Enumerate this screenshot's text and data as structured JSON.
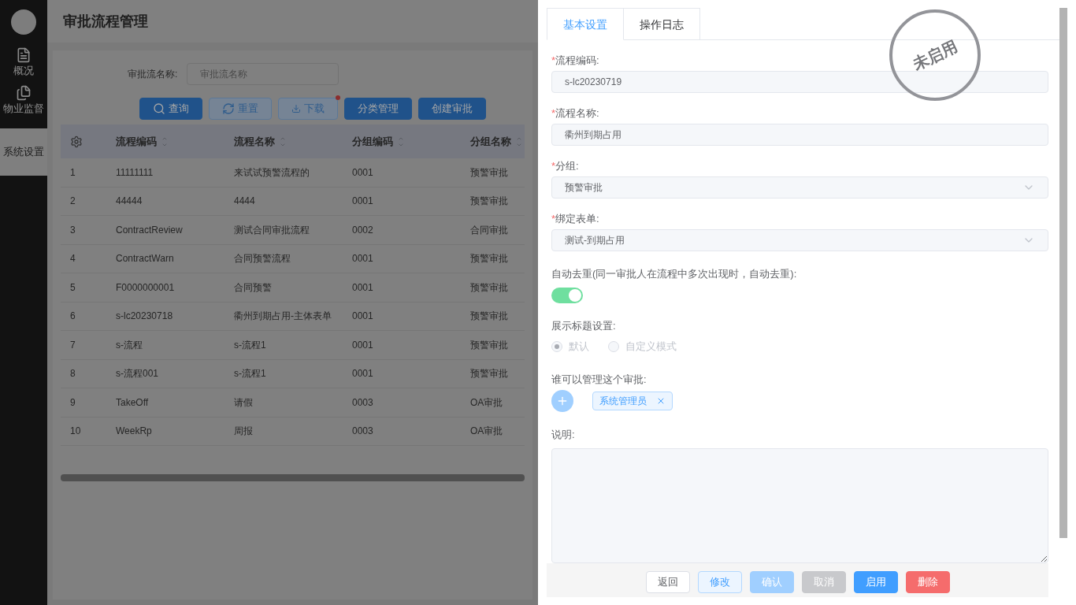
{
  "sidebar": {
    "items": [
      {
        "label": "概况",
        "selected": false
      },
      {
        "label": "物业监督",
        "selected": false
      },
      {
        "label": "系统设置",
        "selected": true
      }
    ]
  },
  "page": {
    "title": "审批流程管理"
  },
  "search": {
    "label": "审批流名称:",
    "placeholder": "审批流名称"
  },
  "toolbar": [
    {
      "label": "查询",
      "kind": "primary",
      "dot": false
    },
    {
      "label": "重置",
      "kind": "plain",
      "dot": false
    },
    {
      "label": "下载",
      "kind": "plain",
      "dot": true
    },
    {
      "label": "分类管理",
      "kind": "primary",
      "dot": false
    },
    {
      "label": "创建审批",
      "kind": "primary",
      "dot": false
    }
  ],
  "table": {
    "columns": [
      "",
      "流程编码",
      "流程名称",
      "分组编码",
      "分组名称"
    ],
    "rows": [
      [
        "1",
        "11111111",
        "来试试预警流程的",
        "0001",
        "预警审批"
      ],
      [
        "2",
        "44444",
        "4444",
        "0001",
        "预警审批"
      ],
      [
        "3",
        "ContractReview",
        "测试合同审批流程",
        "0002",
        "合同审批"
      ],
      [
        "4",
        "ContractWarn",
        "合同预警流程",
        "0001",
        "预警审批"
      ],
      [
        "5",
        "F0000000001",
        "合同预警",
        "0001",
        "预警审批"
      ],
      [
        "6",
        "s-lc20230718",
        "衢州到期占用-主体表单",
        "0001",
        "预警审批"
      ],
      [
        "7",
        "s-流程",
        "s-流程1",
        "0001",
        "预警审批"
      ],
      [
        "8",
        "s-流程001",
        "s-流程1",
        "0001",
        "预警审批"
      ],
      [
        "9",
        "TakeOff",
        "请假",
        "0003",
        "OA审批"
      ],
      [
        "10",
        "WeekRp",
        "周报",
        "0003",
        "OA审批"
      ]
    ]
  },
  "drawer": {
    "tabs": [
      {
        "label": "基本设置",
        "selected": true
      },
      {
        "label": "操作日志",
        "selected": false
      }
    ],
    "stamp": "未启用",
    "fields": [
      {
        "required_mark": "*",
        "label": "流程编码:",
        "kind": "input",
        "value": "s-lc20230719"
      },
      {
        "required_mark": "*",
        "label": "流程名称:",
        "kind": "input",
        "value": "衢州到期占用"
      },
      {
        "required_mark": "*",
        "label": "分组:",
        "kind": "select",
        "value": "预警审批"
      },
      {
        "required_mark": "*",
        "label": "绑定表单:",
        "kind": "select",
        "value": "测试-到期占用"
      }
    ],
    "dedupe": {
      "label": "自动去重(同一审批人在流程中多次出现时，自动去重):",
      "on": true
    },
    "title_setting": {
      "label": "展示标题设置:",
      "options": [
        {
          "label": "默认",
          "selected": true,
          "disabled": true
        },
        {
          "label": "自定义模式",
          "selected": false,
          "disabled": true
        }
      ]
    },
    "managers": {
      "label": "谁可以管理这个审批:",
      "tags": [
        "系统管理员"
      ]
    },
    "description": {
      "label": "说明:"
    },
    "buttons": [
      {
        "label": "返回",
        "kind": "default"
      },
      {
        "label": "修改",
        "kind": "plain"
      },
      {
        "label": "确认",
        "kind": "primary-disabled"
      },
      {
        "label": "取消",
        "kind": "disabled"
      },
      {
        "label": "启用",
        "kind": "primary"
      },
      {
        "label": "删除",
        "kind": "danger"
      }
    ]
  }
}
